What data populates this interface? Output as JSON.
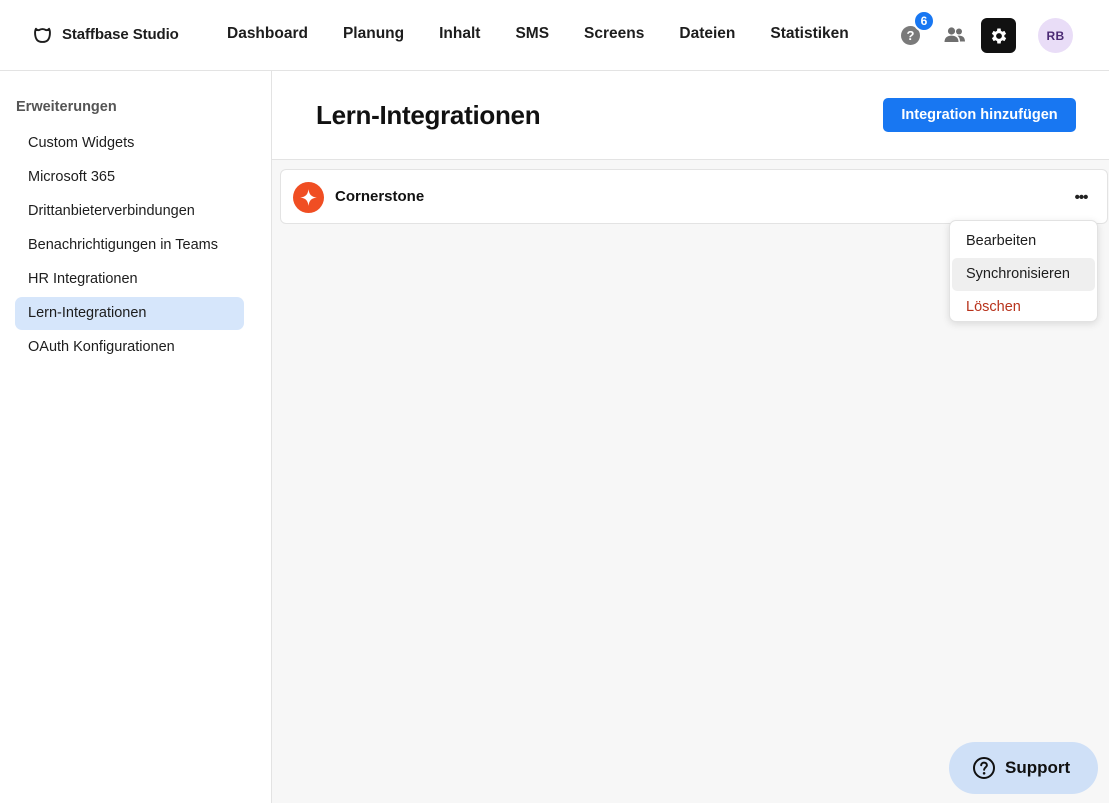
{
  "brand": {
    "name": "Staffbase Studio"
  },
  "nav": {
    "items": [
      "Dashboard",
      "Planung",
      "Inhalt",
      "SMS",
      "Screens",
      "Dateien",
      "Statistiken"
    ]
  },
  "topbar": {
    "help_icon": "question-circle-icon",
    "help_badge": "6",
    "help_symbol": "?",
    "people_icon": "people-icon",
    "settings_icon": "gear-icon",
    "avatar_initials": "RB"
  },
  "sidebar": {
    "heading": "Erweiterungen",
    "items": [
      {
        "label": "Custom Widgets",
        "active": false
      },
      {
        "label": "Microsoft 365",
        "active": false
      },
      {
        "label": "Drittanbieterverbindungen",
        "active": false
      },
      {
        "label": "Benachrichtigungen in Teams",
        "active": false
      },
      {
        "label": "HR Integrationen",
        "active": false
      },
      {
        "label": "Lern-Integrationen",
        "active": true
      },
      {
        "label": "OAuth Konfigurationen",
        "active": false
      }
    ]
  },
  "main": {
    "title": "Lern-Integrationen",
    "add_button": "Integration hinzufügen",
    "integrations": [
      {
        "name": "Cornerstone",
        "logo_icon": "cornerstone-logo-icon"
      }
    ],
    "more_symbol": "•••",
    "context_menu": {
      "items": [
        {
          "label": "Bearbeiten",
          "state": "normal"
        },
        {
          "label": "Synchronisieren",
          "state": "hover"
        },
        {
          "label": "Löschen",
          "state": "danger"
        }
      ]
    }
  },
  "support": {
    "label": "Support",
    "icon": "question-circle-icon"
  },
  "colors": {
    "accent": "#1877f2",
    "active_item_bg": "#d6e6fb",
    "danger": "#b8331c",
    "cornerstone": "#f04e23"
  }
}
